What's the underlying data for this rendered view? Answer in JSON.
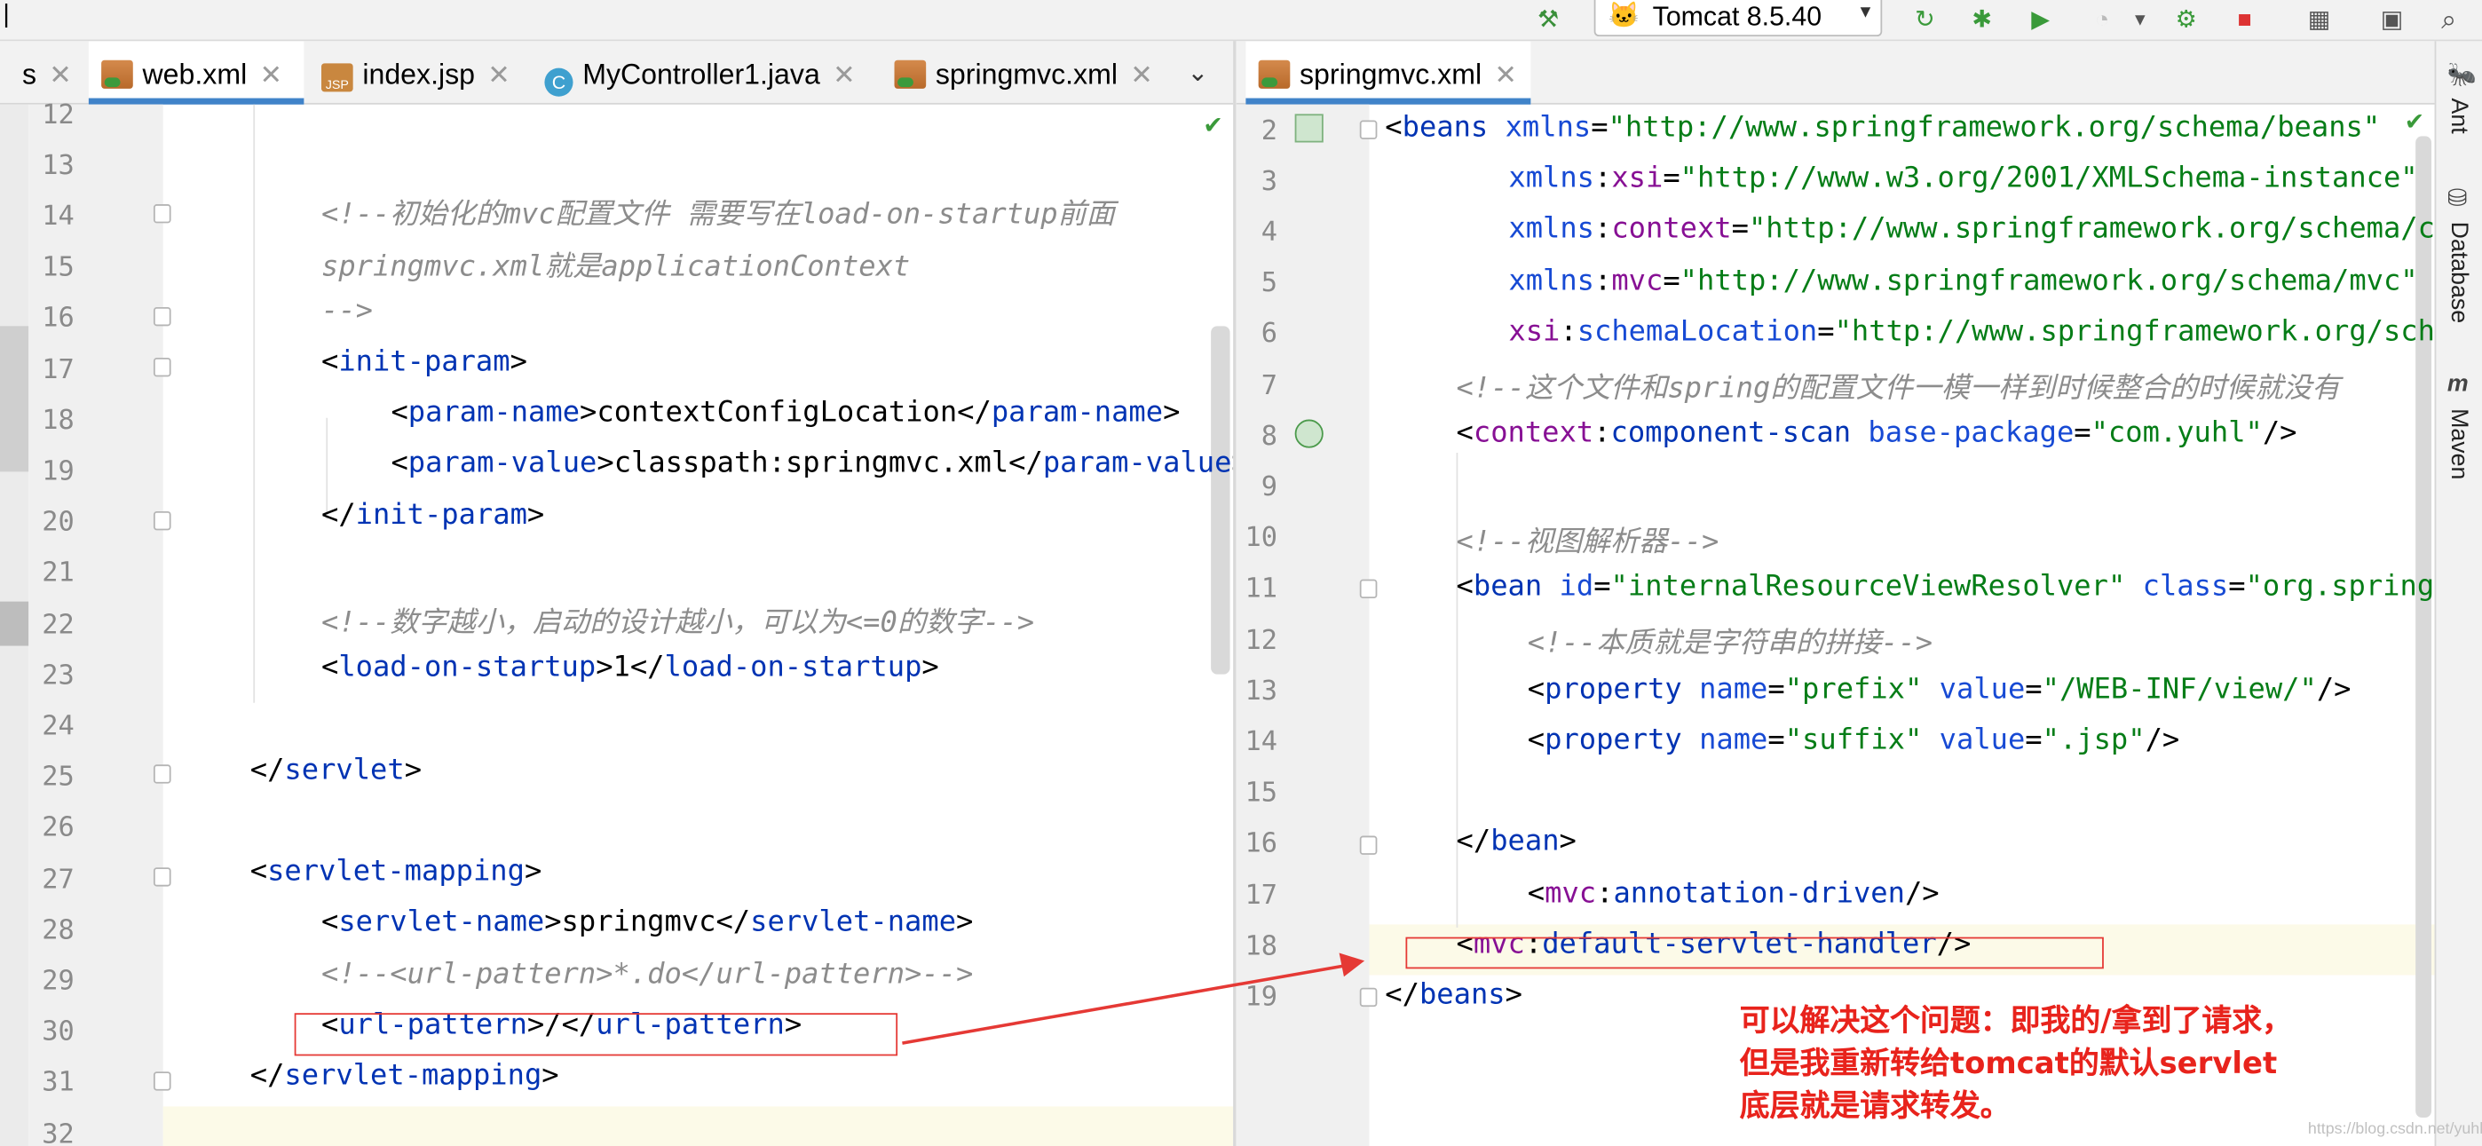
{
  "toolbar": {
    "run_config": "Tomcat 8.5.40",
    "icons": [
      "hammer-icon",
      "rerun-icon",
      "debug-icon",
      "coverage-icon",
      "profile-icon",
      "build-icon",
      "stop-icon",
      "project-structure-icon",
      "terminal-icon",
      "search-icon"
    ]
  },
  "left_editor": {
    "tabs": [
      {
        "label": "s",
        "icon": "",
        "active": false
      },
      {
        "label": "web.xml",
        "icon": "xml-file-icon",
        "active": true
      },
      {
        "label": "index.jsp",
        "icon": "jsp-file-icon",
        "active": false
      },
      {
        "label": "MyController1.java",
        "icon": "java-class-icon",
        "active": false
      },
      {
        "label": "springmvc.xml",
        "icon": "xml-file-icon",
        "active": false
      }
    ],
    "line_numbers": [
      "12",
      "13",
      "14",
      "15",
      "16",
      "17",
      "18",
      "19",
      "20",
      "21",
      "22",
      "23",
      "24",
      "25",
      "26",
      "27",
      "28",
      "29",
      "30",
      "31",
      "32"
    ]
  },
  "right_editor": {
    "tabs": [
      {
        "label": "springmvc.xml",
        "icon": "xml-file-icon",
        "active": true
      }
    ],
    "line_numbers": [
      "2",
      "3",
      "4",
      "5",
      "6",
      "7",
      "8",
      "9",
      "10",
      "11",
      "12",
      "13",
      "14",
      "15",
      "16",
      "17",
      "18",
      "19"
    ]
  },
  "side_tools": [
    "Ant",
    "Database",
    "Maven"
  ],
  "annotation": [
    "可以解决这个问题：即我的/拿到了请求，",
    "但是我重新转给tomcat的默认servlet",
    "底层就是请求转发。"
  ],
  "watermark": "https://blog.csdn.net/yuhl",
  "colors": {
    "tag": "#0033b3",
    "attr": "#174ad4",
    "value": "#067d17",
    "ns": "#871094",
    "comment": "#8c8c8c",
    "highlight_box": "#e53935",
    "annotation_text": "#e8231c",
    "active_tab_underline": "#4083c9"
  }
}
